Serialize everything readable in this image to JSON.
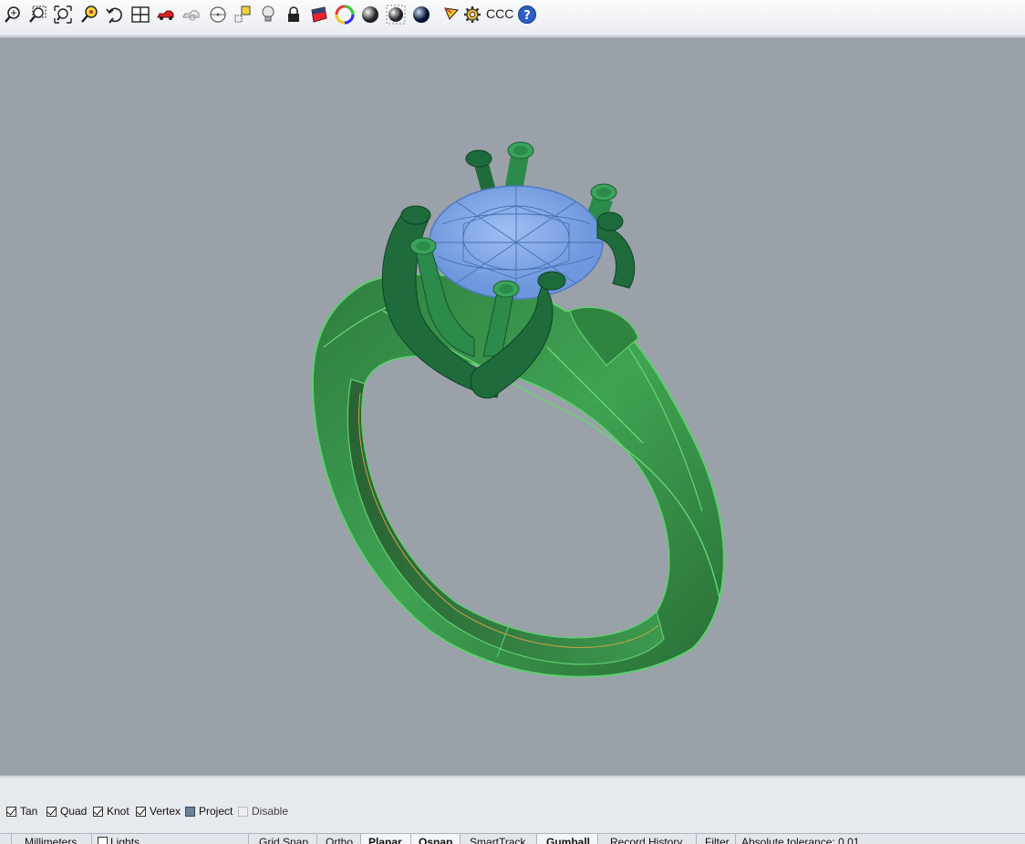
{
  "toolbar": {
    "icons": [
      "zoom-extents-icon",
      "zoom-window-icon",
      "zoom-all-icon",
      "zoom-selected-icon",
      "undo-view-icon",
      "four-viewports-icon",
      "car-render-icon",
      "ghost-icon",
      "cplane-icon",
      "snap-point-icon",
      "light-bulb-icon",
      "lock-icon",
      "material-icon",
      "color-wheel-icon",
      "shaded-sphere-icon",
      "rendered-sphere-icon",
      "blue-sphere-icon",
      "pen-icon",
      "gear-icon"
    ],
    "custom_text": "CCC",
    "help_icon": "help-icon"
  },
  "viewport": {
    "background": "#9aa1a9",
    "model_color": "#3a9a52",
    "gem_color": "#7aa6e6"
  },
  "osnap": {
    "items": [
      {
        "label": "Tan",
        "state": "checked"
      },
      {
        "label": "Quad",
        "state": "checked"
      },
      {
        "label": "Knot",
        "state": "checked"
      },
      {
        "label": "Vertex",
        "state": "checked"
      },
      {
        "label": "Project",
        "state": "filled"
      },
      {
        "label": "Disable",
        "state": "disabled"
      }
    ]
  },
  "statusbar": {
    "units": "Millimeters",
    "layer": "Lights",
    "grid_snap": "Grid Snap",
    "ortho": "Ortho",
    "planar": "Planar",
    "osnap": "Osnap",
    "smarttrack": "SmartTrack",
    "gumball": "Gumball",
    "record_history": "Record History",
    "filter": "Filter",
    "tolerance": "Absolute tolerance: 0.01"
  }
}
